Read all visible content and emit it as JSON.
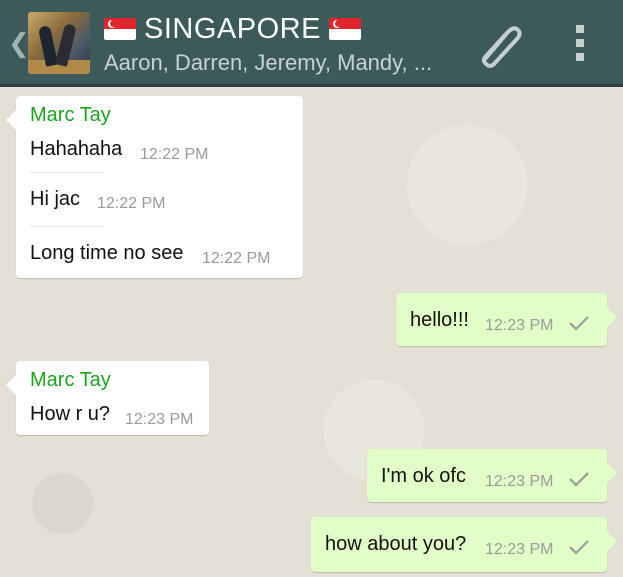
{
  "header": {
    "title": "SINGAPORE",
    "subtitle": "Aaron, Darren, Jeremy, Mandy, ...",
    "flag": "singapore-flag",
    "background_color": "#3d5a5b"
  },
  "messages": [
    {
      "direction": "in",
      "sender": "Marc Tay",
      "lines": [
        {
          "text": "Hahahaha",
          "time": "12:22 PM"
        },
        {
          "text": "Hi jac",
          "time": "12:22 PM"
        },
        {
          "text": "Long time no see",
          "time": "12:22 PM"
        }
      ]
    },
    {
      "direction": "out",
      "text": "hello!!!",
      "time": "12:23 PM",
      "status": "sent"
    },
    {
      "direction": "in",
      "sender": "Marc Tay",
      "lines": [
        {
          "text": "How r u?",
          "time": "12:23 PM"
        }
      ]
    },
    {
      "direction": "out",
      "text": "I'm ok ofc",
      "time": "12:23 PM",
      "status": "sent"
    },
    {
      "direction": "out",
      "text": "how about you?",
      "time": "12:23 PM",
      "status": "sent"
    }
  ],
  "colors": {
    "incoming_bubble": "#ffffff",
    "outgoing_bubble": "#e2ffc7",
    "sender_name": "#1ea31e",
    "timestamp": "#9a9a9a"
  },
  "icons": {
    "back": "back-chevron-icon",
    "attach": "paperclip-icon",
    "menu": "overflow-menu-icon",
    "tick": "check-icon"
  }
}
